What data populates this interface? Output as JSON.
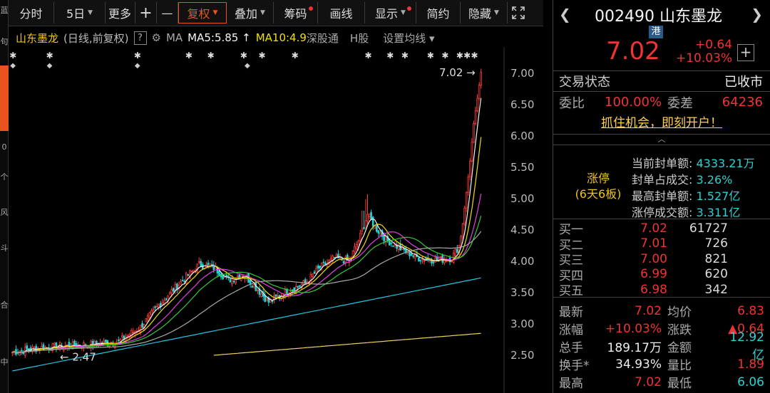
{
  "toolbar": {
    "items": [
      {
        "label": "分时",
        "dropdown": false,
        "dot": false,
        "active": false
      },
      {
        "label": "5日",
        "dropdown": true,
        "dot": false,
        "active": false
      },
      {
        "label": "更多",
        "dropdown": false,
        "dot": false,
        "active": false
      },
      {
        "label": "+",
        "dropdown": false,
        "dot": false,
        "active": false
      },
      {
        "label": "—",
        "dropdown": false,
        "dot": false,
        "active": false
      },
      {
        "label": "复权",
        "dropdown": true,
        "dot": false,
        "active": true
      },
      {
        "label": "叠加",
        "dropdown": true,
        "dot": false,
        "active": false
      },
      {
        "label": "筹码",
        "dropdown": false,
        "dot": true,
        "active": false
      },
      {
        "label": "画线",
        "dropdown": false,
        "dot": false,
        "active": false
      },
      {
        "label": "显示",
        "dropdown": true,
        "dot": true,
        "active": false
      },
      {
        "label": "简约",
        "dropdown": false,
        "dot": false,
        "active": false
      },
      {
        "label": "隐藏",
        "dropdown": true,
        "dot": false,
        "active": false
      }
    ],
    "fullscreen_icon": "expand-arrows-icon"
  },
  "legend": {
    "stock": "山东墨龙",
    "type": "(日线,前复权)",
    "help": "?",
    "ma": "MA",
    "ma5": "MA5:5.85 ↑",
    "ma10": "MA10:4.9",
    "sgt": "深股通",
    "hshare": "H股",
    "setting": "设置均线 ▾"
  },
  "left_strip": {
    "fragments": [
      "蓝",
      "句",
      "0",
      "个",
      "风",
      "斗",
      "合",
      "中"
    ]
  },
  "chart_data": {
    "type": "candlestick",
    "yaxis": {
      "ticks": [
        7.0,
        6.5,
        6.0,
        5.5,
        5.0,
        4.5,
        4.0,
        3.5,
        3.0,
        2.5
      ],
      "ylim": [
        2.12,
        7.1
      ]
    },
    "high_marker": {
      "label": "7.02",
      "value": 7.02
    },
    "low_marker": {
      "label": "2.47",
      "value": 2.47
    },
    "ma_colors": {
      "ma5": "#f5f5f5",
      "ma10": "#f0e000",
      "ma20": "#e040e0",
      "ma30": "#33cc33",
      "ma60": "#aaaaaa",
      "ma120": "#22c4e0",
      "ma250": "#f0d060"
    }
  },
  "quote": {
    "code": "002490",
    "name": "山东墨龙",
    "badge": "港",
    "price": "7.02",
    "change": "+0.64",
    "change_pct": "+10.03%",
    "trade_status_label": "交易状态",
    "trade_status_value": "已收市",
    "weibi_label": "委比",
    "weibi_value": "100.00%",
    "weicha_label": "委差",
    "weicha_value": "64236",
    "promo": "抓住机会，即刻开户！",
    "limit_up": {
      "title_line1": "涨停",
      "title_line2": "(6天6板)",
      "seal_amount_label": "当前封单额:",
      "seal_amount": "4333.21万",
      "seal_ratio_label": "封单占成交:",
      "seal_ratio": "3.26%",
      "max_seal_label": "最高封单额:",
      "max_seal": "1.527亿",
      "limit_turnover_label": "涨停成交额:",
      "limit_turnover": "3.311亿"
    },
    "bids": [
      {
        "label": "买一",
        "price": "7.02",
        "volume": "61727"
      },
      {
        "label": "买二",
        "price": "7.01",
        "volume": "726"
      },
      {
        "label": "买三",
        "price": "7.00",
        "volume": "821"
      },
      {
        "label": "买四",
        "price": "6.99",
        "volume": "620"
      },
      {
        "label": "买五",
        "price": "6.98",
        "volume": "342"
      }
    ],
    "stats": [
      {
        "k1": "最新",
        "v1": "7.02",
        "c1": "red",
        "k2": "均价",
        "v2": "6.83",
        "c2": "red"
      },
      {
        "k1": "涨幅",
        "v1": "+10.03%",
        "c1": "red",
        "k2": "涨跌",
        "v2": "▲0.64",
        "c2": "red"
      },
      {
        "k1": "总手",
        "v1": "189.17万",
        "c1": "white",
        "k2": "金额",
        "v2": "12.92亿",
        "c2": "cyan"
      },
      {
        "k1": "换手*",
        "v1": "34.93%",
        "c1": "white",
        "k2": "量比",
        "v2": "1.89",
        "c2": "red"
      },
      {
        "k1": "最高",
        "v1": "7.02",
        "c1": "red",
        "k2": "最低",
        "v2": "6.06",
        "c2": "cyan"
      }
    ]
  }
}
